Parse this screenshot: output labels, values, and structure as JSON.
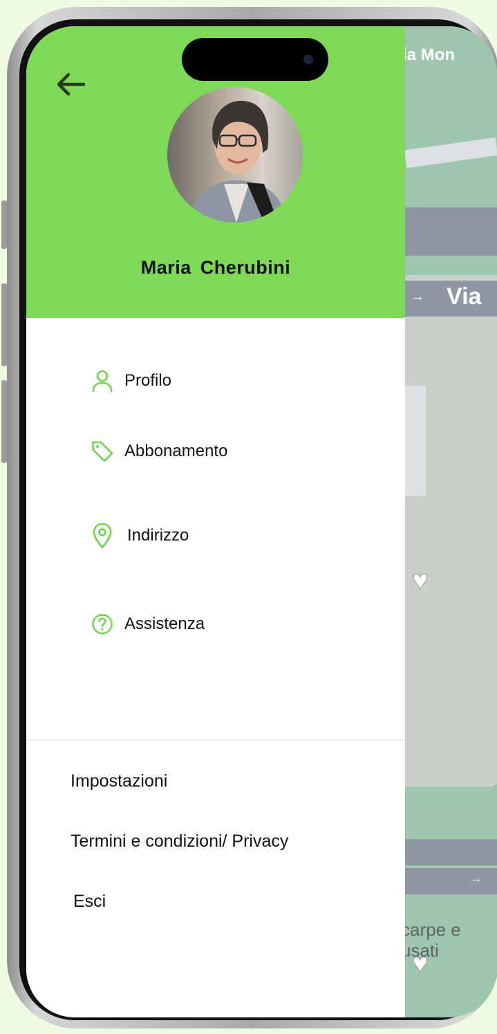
{
  "drawer": {
    "user_name": "Maria  Cherubini",
    "menu": [
      {
        "label": "Profilo",
        "icon": "user-icon"
      },
      {
        "label": "Abbonamento",
        "icon": "tag-icon"
      },
      {
        "label": "Indirizzo",
        "icon": "location-pin-icon"
      },
      {
        "label": "Assistenza",
        "icon": "help-circle-icon"
      }
    ],
    "footer": [
      {
        "label": "Impostazioni"
      },
      {
        "label": "Termini e condizioni/ Privacy"
      },
      {
        "label": "Esci"
      }
    ]
  },
  "map": {
    "street_top": "ia Mon",
    "street_mid": "Via",
    "place_line1": "carpe e",
    "place_line2": "usati"
  },
  "colors": {
    "accent": "#7ed957",
    "background": "#effce2"
  }
}
